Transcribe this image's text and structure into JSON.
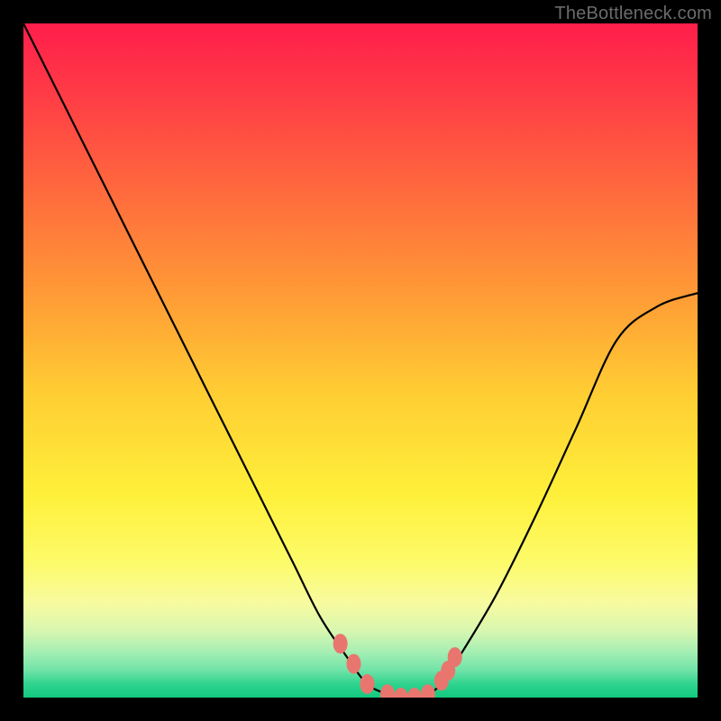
{
  "watermark": "TheBottleneck.com",
  "colors": {
    "bg": "#000000",
    "curve": "#000000",
    "marker": "#e9766e",
    "gradient_top": "#ff1e4b",
    "gradient_bottom": "#12c97e"
  },
  "chart_data": {
    "type": "line",
    "title": "",
    "xlabel": "",
    "ylabel": "",
    "xlim": [
      0,
      100
    ],
    "ylim": [
      0,
      100
    ],
    "series": [
      {
        "name": "bottleneck-curve",
        "x": [
          0,
          6,
          12,
          18,
          24,
          30,
          36,
          40,
          44,
          48,
          51,
          54,
          56,
          58,
          60,
          62,
          64,
          70,
          76,
          82,
          88,
          94,
          100
        ],
        "values": [
          100,
          88,
          76,
          64,
          52,
          40,
          28,
          20,
          12,
          6,
          2,
          0.5,
          0,
          0,
          0.5,
          2,
          5,
          15,
          27,
          40,
          53,
          58,
          60
        ]
      }
    ],
    "markers": {
      "name": "highlight-points",
      "x": [
        47,
        49,
        51,
        54,
        56,
        58,
        60,
        62,
        63,
        64
      ],
      "values": [
        8,
        5,
        2,
        0.5,
        0,
        0,
        0.5,
        2.5,
        4,
        6
      ]
    },
    "annotations": []
  }
}
